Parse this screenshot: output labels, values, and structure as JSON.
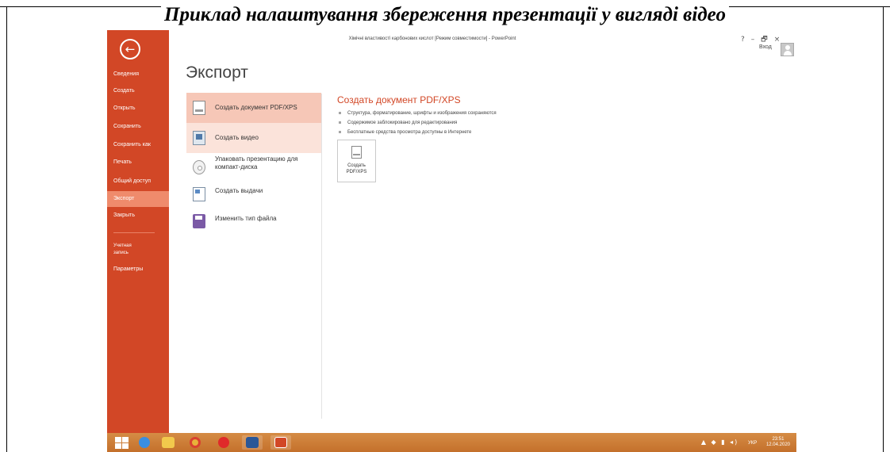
{
  "caption": "Приклад налаштування збереження презентації у вигляді відео",
  "window": {
    "title": "Хімічні властивості карбонових кислот [Режим совместимости] - PowerPoint",
    "help": "?",
    "minimize": "–",
    "restore": "🗗",
    "close": "×",
    "login_label": "Вход"
  },
  "sidebar": {
    "back_icon": "←",
    "items": [
      {
        "label": "Сведения"
      },
      {
        "label": "Создать"
      },
      {
        "label": "Открыть"
      },
      {
        "label": "Сохранить"
      },
      {
        "label": "Сохранить как"
      },
      {
        "label": "Печать"
      },
      {
        "label": "Общий доступ"
      },
      {
        "label": "Экспорт",
        "active": true
      },
      {
        "label": "Закрыть"
      },
      {
        "label": "Учетная запись"
      },
      {
        "label": "Параметры"
      }
    ]
  },
  "page": {
    "heading": "Экспорт"
  },
  "options": [
    {
      "label": "Создать документ PDF/XPS",
      "icon": "pdf-document-icon",
      "state": "selected"
    },
    {
      "label": "Создать видео",
      "icon": "video-icon",
      "state": "hover"
    },
    {
      "label": "Упаковать презентацию для компакт-диска",
      "icon": "cd-icon"
    },
    {
      "label": "Создать выдачи",
      "icon": "handout-icon"
    },
    {
      "label": "Изменить тип файла",
      "icon": "save-icon"
    }
  ],
  "detail": {
    "title": "Создать документ PDF/XPS",
    "bullets": [
      "Структура, форматирование, шрифты и изображения сохраняются",
      "Содержимое заблокировано для редактирования",
      "Бесплатные средства просмотра доступны в Интернете"
    ],
    "button_label": "Создать\nPDF/XPS"
  },
  "taskbar": {
    "apps": [
      "windows-start-icon",
      "internet-explorer-icon",
      "file-explorer-icon",
      "chrome-icon",
      "opera-icon",
      "word-icon",
      "powerpoint-icon"
    ],
    "language": "УКР",
    "time": "23:51",
    "date": "12.04.2020"
  },
  "colors": {
    "accent": "#d24726",
    "selected": "#f6c7b7",
    "hover": "#fbe3da"
  }
}
